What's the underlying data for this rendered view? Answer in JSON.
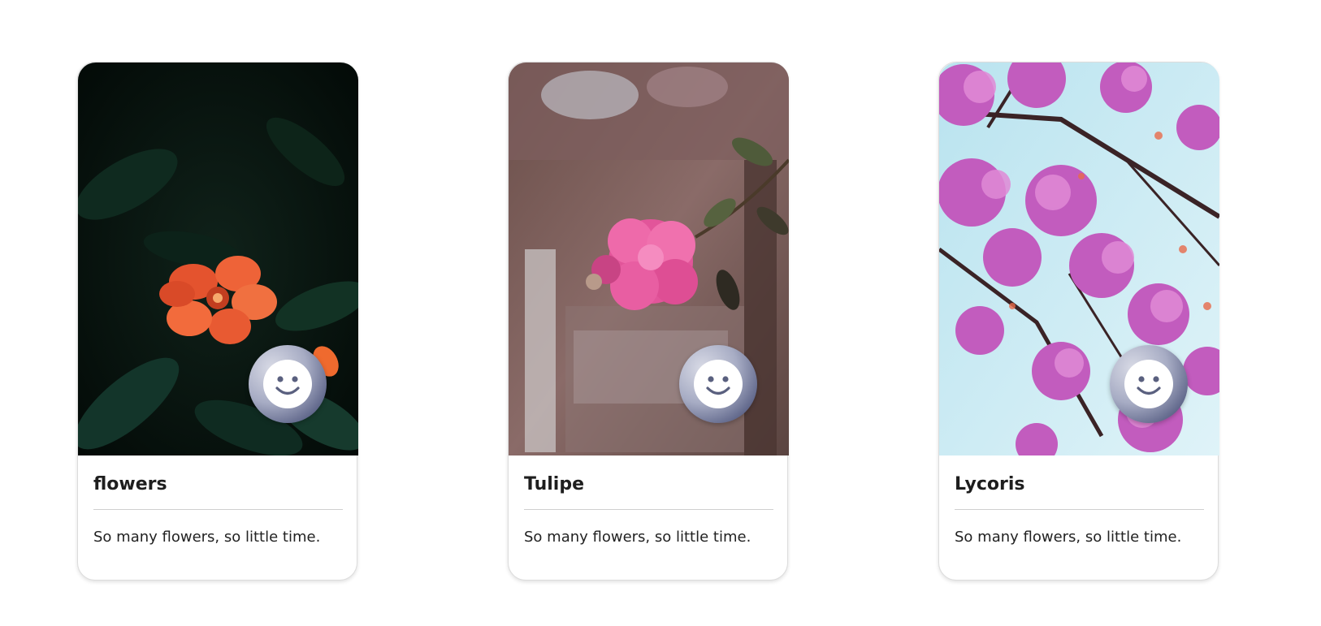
{
  "cards": [
    {
      "title": "flowers",
      "description": "So many flowers, so little time.",
      "image_subject": "orange-flower-photo",
      "avatar_icon": "smiley-face-icon"
    },
    {
      "title": "Tulipe",
      "description": "So many flowers, so little time.",
      "image_subject": "pink-blossom-branch-photo",
      "avatar_icon": "smiley-face-icon"
    },
    {
      "title": "Lycoris",
      "description": "So many flowers, so little time.",
      "image_subject": "pink-tree-blossoms-photo",
      "avatar_icon": "smiley-face-icon"
    }
  ],
  "colors": {
    "avatar_gradient_light": "#d9dbe6",
    "avatar_gradient_dark": "#3f4668",
    "title_text": "#1e1e1e",
    "body_text": "#222222",
    "divider": "#cfcfcf",
    "card_border": "#dcdcdc"
  }
}
